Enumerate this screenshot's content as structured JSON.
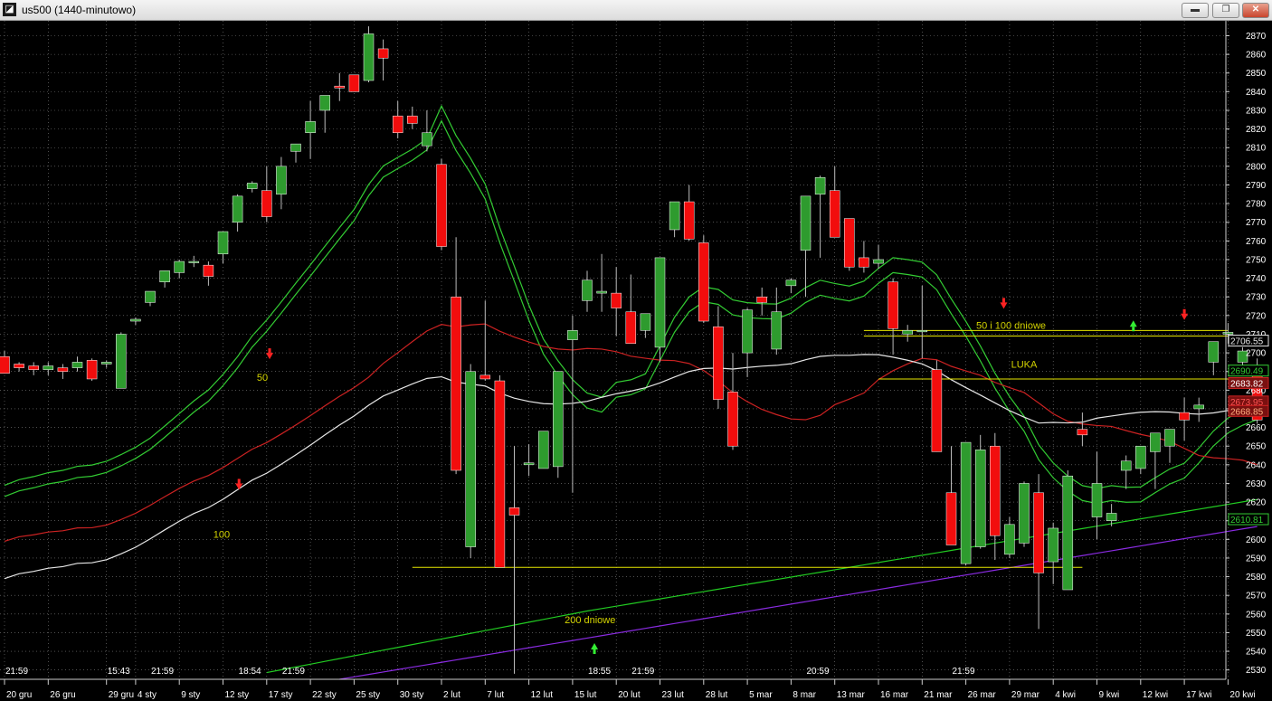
{
  "window": {
    "title": "us500 (1440-minutowo)",
    "icons": {
      "app": "chart-app-icon",
      "minimize": "minimize-icon",
      "restore": "restore-icon",
      "close": "close-icon"
    }
  },
  "chart_data": {
    "type": "candlestick",
    "symbol": "us500",
    "timeframe": "1440-minutowo",
    "ylim": [
      2525,
      2878
    ],
    "y_ticks": [
      2530,
      2540,
      2550,
      2560,
      2570,
      2580,
      2590,
      2600,
      2610,
      2620,
      2630,
      2640,
      2650,
      2660,
      2670,
      2680,
      2690,
      2700,
      2710,
      2720,
      2730,
      2740,
      2750,
      2760,
      2770,
      2780,
      2790,
      2800,
      2810,
      2820,
      2830,
      2840,
      2850,
      2860,
      2870
    ],
    "x_time_labels": [
      {
        "i": 0,
        "label": "21:59"
      },
      {
        "i": 7,
        "label": "15:43"
      },
      {
        "i": 10,
        "label": "21:59"
      },
      {
        "i": 16,
        "label": "18:54"
      },
      {
        "i": 19,
        "label": "21:59"
      },
      {
        "i": 40,
        "label": "18:55"
      },
      {
        "i": 43,
        "label": "21:59"
      },
      {
        "i": 55,
        "label": "20:59"
      },
      {
        "i": 65,
        "label": "21:59"
      }
    ],
    "x_date_labels": [
      {
        "i": 0,
        "label": "20 gru"
      },
      {
        "i": 3,
        "label": "26 gru"
      },
      {
        "i": 7,
        "label": "29 gru"
      },
      {
        "i": 9,
        "label": "4 sty"
      },
      {
        "i": 12,
        "label": "9 sty"
      },
      {
        "i": 15,
        "label": "12 sty"
      },
      {
        "i": 18,
        "label": "17 sty"
      },
      {
        "i": 21,
        "label": "22 sty"
      },
      {
        "i": 24,
        "label": "25 sty"
      },
      {
        "i": 27,
        "label": "30 sty"
      },
      {
        "i": 30,
        "label": "2 lut"
      },
      {
        "i": 33,
        "label": "7 lut"
      },
      {
        "i": 36,
        "label": "12 lut"
      },
      {
        "i": 39,
        "label": "15 lut"
      },
      {
        "i": 42,
        "label": "20 lut"
      },
      {
        "i": 45,
        "label": "23 lut"
      },
      {
        "i": 48,
        "label": "28 lut"
      },
      {
        "i": 51,
        "label": "5 mar"
      },
      {
        "i": 54,
        "label": "8 mar"
      },
      {
        "i": 57,
        "label": "13 mar"
      },
      {
        "i": 60,
        "label": "16 mar"
      },
      {
        "i": 63,
        "label": "21 mar"
      },
      {
        "i": 66,
        "label": "26 mar"
      },
      {
        "i": 69,
        "label": "29 mar"
      },
      {
        "i": 72,
        "label": "4 kwi"
      },
      {
        "i": 75,
        "label": "9 kwi"
      },
      {
        "i": 78,
        "label": "12 kwi"
      },
      {
        "i": 81,
        "label": "17 kwi"
      },
      {
        "i": 84,
        "label": "20 kwi"
      }
    ],
    "candles": [
      [
        2698,
        2701,
        2689,
        2689
      ],
      [
        2694,
        2695,
        2690,
        2692
      ],
      [
        2693,
        2695,
        2688,
        2691
      ],
      [
        2691,
        2695,
        2688,
        2693
      ],
      [
        2692,
        2694,
        2686,
        2690
      ],
      [
        2692,
        2698,
        2690,
        2695
      ],
      [
        2696,
        2697,
        2685,
        2686
      ],
      [
        2694,
        2696,
        2692,
        2695
      ],
      [
        2681,
        2711,
        2681,
        2710
      ],
      [
        2717,
        2719,
        2715,
        2718
      ],
      [
        2727,
        2733,
        2725,
        2733
      ],
      [
        2738,
        2744,
        2735,
        2744
      ],
      [
        2743,
        2750,
        2740,
        2749
      ],
      [
        2749,
        2752,
        2746,
        2749
      ],
      [
        2747,
        2749,
        2736,
        2741
      ],
      [
        2753,
        2757,
        2748,
        2765
      ],
      [
        2770,
        2785,
        2765,
        2784
      ],
      [
        2788,
        2792,
        2786,
        2791
      ],
      [
        2787,
        2800,
        2770,
        2773
      ],
      [
        2785,
        2805,
        2777,
        2800
      ],
      [
        2808,
        2810,
        2802,
        2812
      ],
      [
        2818,
        2835,
        2804,
        2824
      ],
      [
        2830,
        2838,
        2818,
        2838
      ],
      [
        2843,
        2850,
        2835,
        2842
      ],
      [
        2849,
        2847,
        2842,
        2840
      ],
      [
        2846,
        2875,
        2845,
        2871
      ],
      [
        2863,
        2868,
        2846,
        2858
      ],
      [
        2827,
        2835,
        2815,
        2818
      ],
      [
        2827,
        2832,
        2820,
        2823
      ],
      [
        2811,
        2830,
        2808,
        2818
      ],
      [
        2801,
        2804,
        2755,
        2757
      ],
      [
        2730,
        2762,
        2635,
        2637
      ],
      [
        2596,
        2694,
        2590,
        2690
      ],
      [
        2688,
        2728,
        2685,
        2686
      ],
      [
        2685,
        2688,
        2585,
        2585
      ],
      [
        2617,
        2650,
        2528,
        2613
      ],
      [
        2640,
        2651,
        2634,
        2641
      ],
      [
        2638,
        2652,
        2638,
        2658
      ],
      [
        2639,
        2671,
        2633,
        2690
      ],
      [
        2707,
        2720,
        2625,
        2712
      ],
      [
        2728,
        2744,
        2722,
        2739
      ],
      [
        2732,
        2753,
        2722,
        2733
      ],
      [
        2732,
        2746,
        2709,
        2724
      ],
      [
        2722,
        2742,
        2709,
        2705
      ],
      [
        2712,
        2701,
        2708,
        2721
      ],
      [
        2703,
        2750,
        2695,
        2751
      ],
      [
        2766,
        2780,
        2762,
        2781
      ],
      [
        2781,
        2790,
        2760,
        2761
      ],
      [
        2759,
        2763,
        2716,
        2717
      ],
      [
        2714,
        2725,
        2670,
        2675
      ],
      [
        2679,
        2700,
        2648,
        2650
      ],
      [
        2700,
        2724,
        2687,
        2723
      ],
      [
        2730,
        2735,
        2720,
        2727
      ],
      [
        2702,
        2735,
        2699,
        2722
      ],
      [
        2736,
        2740,
        2732,
        2739
      ],
      [
        2755,
        2755,
        2730,
        2784
      ],
      [
        2785,
        2795,
        2751,
        2794
      ],
      [
        2787,
        2800,
        2763,
        2762
      ],
      [
        2772,
        2769,
        2744,
        2746
      ],
      [
        2751,
        2760,
        2743,
        2746
      ],
      [
        2748,
        2758,
        2745,
        2750
      ],
      [
        2738,
        2740,
        2699,
        2713
      ],
      [
        2710,
        2715,
        2706,
        2712
      ],
      [
        2712,
        2736,
        2697,
        2712
      ],
      [
        2691,
        2696,
        2680,
        2647
      ],
      [
        2625,
        2650,
        2600,
        2597
      ],
      [
        2587,
        2650,
        2586,
        2652
      ],
      [
        2596,
        2656,
        2595,
        2648
      ],
      [
        2650,
        2657,
        2589,
        2602
      ],
      [
        2592,
        2612,
        2590,
        2608
      ],
      [
        2598,
        2631,
        2596,
        2630
      ],
      [
        2625,
        2635,
        2552,
        2582
      ],
      [
        2588,
        2609,
        2576,
        2606
      ],
      [
        2573,
        2637,
        2573,
        2634
      ],
      [
        2659,
        2668,
        2650,
        2656
      ],
      [
        2612,
        2647,
        2600,
        2630
      ],
      [
        2610,
        2619,
        2607,
        2614
      ],
      [
        2637,
        2645,
        2627,
        2642
      ],
      [
        2638,
        2645,
        2635,
        2650
      ],
      [
        2647,
        2651,
        2627,
        2657
      ],
      [
        2650,
        2656,
        2641,
        2659
      ],
      [
        2668,
        2676,
        2653,
        2664
      ],
      [
        2670,
        2676,
        2663,
        2672
      ],
      [
        2695,
        2704,
        2688,
        2706
      ],
      [
        2710,
        2716,
        2705,
        2711
      ],
      [
        2695,
        2703,
        2690,
        2701
      ],
      [
        2689,
        2697,
        2662,
        2664
      ]
    ],
    "overlays": [
      {
        "name": "50",
        "color": "#33cc33",
        "values": "upper-green-band"
      },
      {
        "name": "100",
        "color": "#cc2222"
      },
      {
        "name": "white-ma",
        "color": "#e6e6e6"
      },
      {
        "name": "200",
        "color": "#22cc22"
      },
      {
        "name": "lower-purple",
        "color": "#8a2be2"
      }
    ],
    "price_labels": [
      {
        "value": "2706.55",
        "bg": "#000000",
        "fg": "#e6e6e6",
        "border": "#e6e6e6"
      },
      {
        "value": "2690.49",
        "bg": "#000000",
        "fg": "#33cc33",
        "border": "#33cc33"
      },
      {
        "value": "2683.82",
        "bg": "#7a1010",
        "fg": "#ffffff",
        "border": "#cc2222"
      },
      {
        "value": "2673.95",
        "bg": "#7a1010",
        "fg": "#ff5555",
        "border": "#cc2222"
      },
      {
        "value": "2668.85",
        "bg": "#7a1010",
        "fg": "#ffb080",
        "border": "#cc2222"
      },
      {
        "value": "2610.81",
        "bg": "#000000",
        "fg": "#33cc33",
        "border": "#33cc33"
      }
    ],
    "annotations": [
      {
        "text": "50",
        "x": "left",
        "color": "#d4d400"
      },
      {
        "text": "100",
        "x": "left",
        "color": "#d4d400"
      },
      {
        "text": "200 dniowe",
        "color": "#d4d400"
      },
      {
        "text": "50 i 100 dniowe",
        "color": "#d4d400"
      },
      {
        "text": "LUKA",
        "color": "#d4d400"
      }
    ],
    "colors": {
      "bull": "#2e9b2e",
      "bear": "#f20d0d",
      "wick": "#bbbbbb",
      "grid": "#808080",
      "bg": "#000000",
      "hline": "#e6e600"
    }
  }
}
